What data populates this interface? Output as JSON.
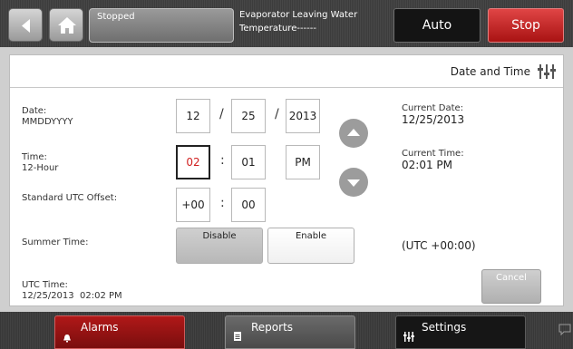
{
  "topbar": {
    "status": "Stopped",
    "evap_line1": "Evaporator Leaving Water",
    "evap_line2": "Temperature------",
    "auto_label": "Auto",
    "stop_label": "Stop",
    "colors": {
      "stop": "#c41e1e"
    }
  },
  "icons": {
    "back": "back-arrow-icon",
    "home": "home-icon",
    "settings": "tune-sliders-icon",
    "alarm": "bell-icon",
    "report": "document-icon",
    "chat": "chat-bubble-icon"
  },
  "panel": {
    "title": "Date and Time",
    "date": {
      "label": "Date:",
      "sublabel": "MMDDYYYY",
      "month": "12",
      "day": "25",
      "year": "2013",
      "sep": "/"
    },
    "time": {
      "label": "Time:",
      "sublabel": "12-Hour",
      "hour": "02",
      "minute": "01",
      "ampm": "PM",
      "sep": ":"
    },
    "utc_offset": {
      "label": "Standard UTC Offset:",
      "hours": "+00",
      "minutes": "00",
      "sep": ":"
    },
    "summer": {
      "label": "Summer Time:",
      "disable": "Disable",
      "enable": "Enable"
    },
    "current_date": {
      "label": "Current Date:",
      "value": "12/25/2013"
    },
    "current_time": {
      "label": "Current Time:",
      "value": "02:01 PM"
    },
    "utc_display": "(UTC +00:00)",
    "utc_time": {
      "label": "UTC Time:",
      "value": "12/25/2013  02:02 PM"
    },
    "cancel_label": "Cancel"
  },
  "bottombar": {
    "alarms": "Alarms",
    "reports": "Reports",
    "settings": "Settings"
  }
}
